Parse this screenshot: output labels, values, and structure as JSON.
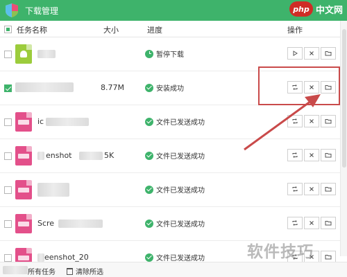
{
  "window": {
    "title": "下载管理"
  },
  "watermark": {
    "php": "php",
    "php_suffix": "中文网",
    "site": "软件技巧"
  },
  "header": {
    "name": "任务名称",
    "size": "大小",
    "progress": "进度",
    "actions": "操作"
  },
  "rows": [
    {
      "name": "",
      "size": "",
      "status": "暂停下载",
      "status_icon": "clock",
      "file_type": "apk",
      "checked": false,
      "actions": [
        "play-icon",
        "close-icon",
        "folder-icon"
      ]
    },
    {
      "name": "",
      "size": "8.77M",
      "status": "安装成功",
      "status_icon": "check",
      "file_type": "apk-blank",
      "checked": true,
      "actions": [
        "refresh-icon",
        "close-icon",
        "folder-icon"
      ]
    },
    {
      "name": "ic",
      "size": "",
      "status": "文件已发送成功",
      "status_icon": "check",
      "file_type": "image",
      "checked": false,
      "actions": [
        "refresh-icon",
        "close-icon",
        "folder-icon"
      ]
    },
    {
      "name": "enshot",
      "size": "5K",
      "status": "文件已发送成功",
      "status_icon": "check",
      "file_type": "image",
      "checked": false,
      "actions": [
        "refresh-icon",
        "close-icon",
        "folder-icon"
      ]
    },
    {
      "name": "",
      "size": "",
      "status": "文件已发送成功",
      "status_icon": "check",
      "file_type": "image",
      "checked": false,
      "actions": [
        "refresh-icon",
        "close-icon",
        "folder-icon"
      ]
    },
    {
      "name": "Scre",
      "size": "",
      "status": "文件已发送成功",
      "status_icon": "check",
      "file_type": "image",
      "checked": false,
      "actions": [
        "refresh-icon",
        "close-icon",
        "folder-icon"
      ]
    },
    {
      "name": "eenshot_20",
      "size": "",
      "status": "文件已发送成功",
      "status_icon": "check",
      "file_type": "image",
      "checked": false,
      "actions": [
        "refresh-icon",
        "close-icon",
        "folder-icon"
      ]
    }
  ],
  "footer": {
    "all_tasks": "所有任务",
    "clear": "清除所选"
  },
  "colors": {
    "accent": "#3eb36b",
    "highlight": "#c94a4a",
    "image_file": "#e3508a",
    "apk_file": "#9ccc3c"
  }
}
